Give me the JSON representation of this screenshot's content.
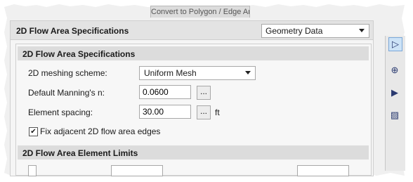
{
  "window": {
    "background_tab_label": "Convert to Polygon / Edge Area"
  },
  "outer": {
    "title": "2D Flow Area Specifications",
    "dropdown_value": "Geometry Data"
  },
  "inner": {
    "section_title": "2D Flow Area Specifications",
    "meshing_label": "2D meshing scheme:",
    "meshing_value": "Uniform Mesh",
    "mannings_label": "Default Manning's n:",
    "mannings_value": "0.0600",
    "spacing_label": "Element spacing:",
    "spacing_value": "30.00",
    "spacing_unit": "ft",
    "ellipsis_label": "...",
    "fix_edges_label": "Fix adjacent 2D flow area edges",
    "fix_edges_checked": true,
    "limits_title": "2D Flow Area Element Limits"
  },
  "icons": {
    "dropdown_caret": "chevron-down-icon",
    "checkbox_mark": "checkmark-icon",
    "side_tools": [
      "arrow-select-icon",
      "zoom-icon",
      "play-icon",
      "hatch-icon"
    ]
  },
  "colors": {
    "header_bg": "#e3e3e3",
    "section_bg": "#dcdcdc",
    "panel_bg": "#f5f5f5",
    "tool_highlight": "#cde3f7"
  }
}
